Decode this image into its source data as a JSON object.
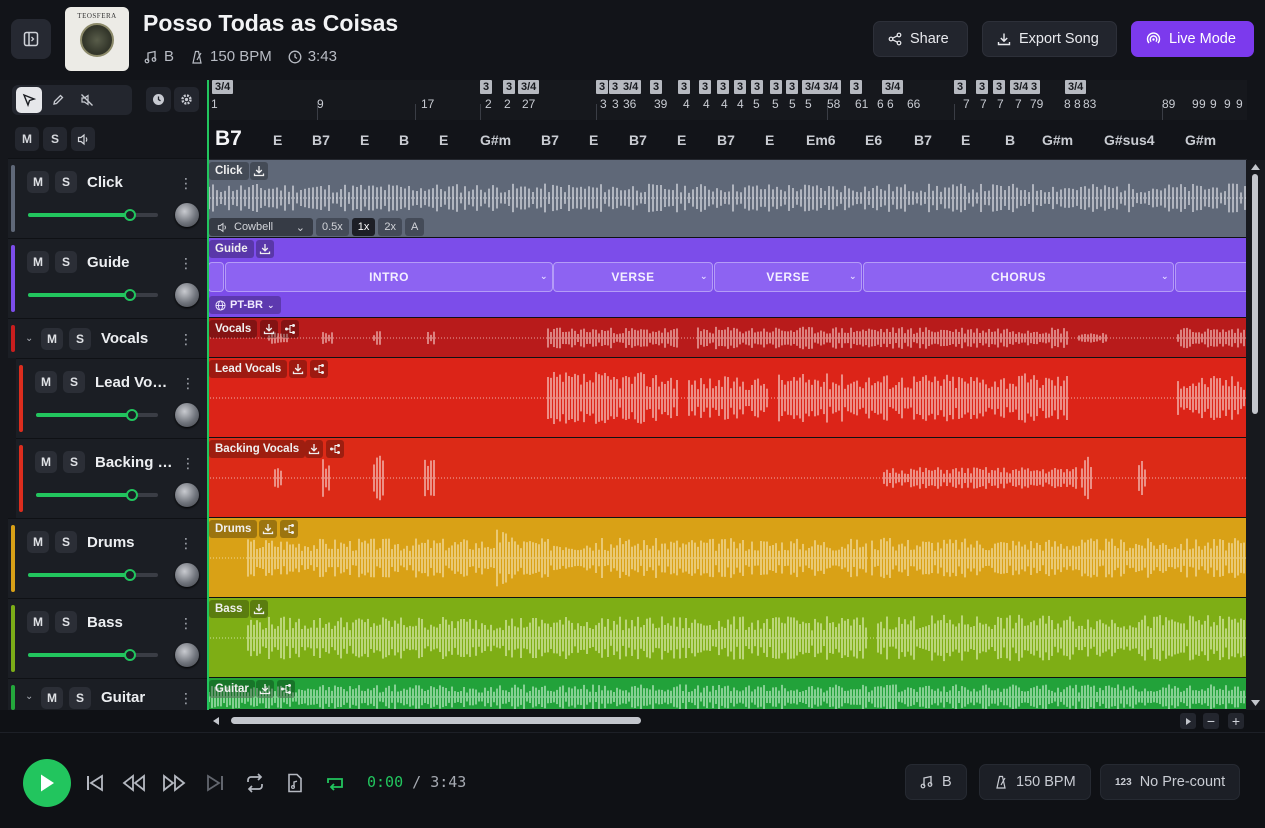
{
  "header": {
    "title": "Posso Todas as Coisas",
    "key": "B",
    "bpm": "150 BPM",
    "duration": "3:43",
    "cover_text": "TEOSFERA",
    "share_label": "Share",
    "export_label": "Export Song",
    "live_label": "Live Mode"
  },
  "mixer": {
    "master_mute": "M",
    "master_solo": "S"
  },
  "tracks": [
    {
      "name": "Click",
      "color": "#5f6878",
      "m": "M",
      "s": "S"
    },
    {
      "name": "Guide",
      "color": "#7c4dea",
      "m": "M",
      "s": "S"
    },
    {
      "name": "Vocals",
      "color": "#c81e1e",
      "m": "M",
      "s": "S"
    },
    {
      "name": "Lead Voc…",
      "color": "#dc2d1e",
      "m": "M",
      "s": "S"
    },
    {
      "name": "Backing …",
      "color": "#dc2d1e",
      "m": "M",
      "s": "S"
    },
    {
      "name": "Drums",
      "color": "#d8a017",
      "m": "M",
      "s": "S"
    },
    {
      "name": "Bass",
      "color": "#7cad18",
      "m": "M",
      "s": "S"
    },
    {
      "name": "Guitar",
      "color": "#24a83c",
      "m": "M",
      "s": "S"
    }
  ],
  "lanes": {
    "click": "Click",
    "guide": "Guide",
    "vocals": "Vocals",
    "lead": "Lead Vocals",
    "backing": "Backing Vocals",
    "drums": "Drums",
    "bass": "Bass",
    "guitar": "Guitar"
  },
  "click_controls": {
    "sound": "Cowbell",
    "rates": [
      "0.5x",
      "1x",
      "2x"
    ],
    "accent": "A"
  },
  "guide": {
    "language": "PT-BR",
    "sections": [
      "INTRO",
      "VERSE",
      "VERSE",
      "CHORUS",
      "VE"
    ]
  },
  "ruler": {
    "bars": [
      "1",
      "9",
      "17",
      "2",
      "2",
      "27",
      "3",
      "3",
      "36",
      "39",
      "4",
      "4",
      "4",
      "4",
      "5",
      "5",
      "5",
      "5",
      "58",
      "61",
      "6",
      "6",
      "66",
      "7",
      "7",
      "7",
      "7",
      "79",
      "8",
      "8",
      "83",
      "89",
      "9",
      "9",
      "9",
      "9",
      "9"
    ],
    "time_signatures": [
      "3/4",
      "3",
      "3",
      "3/4",
      "3",
      "3",
      "3/4",
      "3",
      "3",
      "3",
      "3",
      "3",
      "3",
      "3",
      "3",
      "3/4",
      "3/4",
      "3",
      "3/4",
      "3",
      "3",
      "3",
      "3/4",
      "3",
      "3/4"
    ]
  },
  "chords": [
    "B7",
    "E",
    "B7",
    "E",
    "B",
    "E",
    "G#m",
    "B7",
    "E",
    "B7",
    "E",
    "B7",
    "E",
    "Em6",
    "E6",
    "B7",
    "E",
    "B",
    "G#m",
    "G#sus4",
    "G#m"
  ],
  "transport": {
    "current_time": "0:00",
    "separator": "/",
    "total_time": "3:43",
    "key_pill": "B",
    "bpm_pill": "150 BPM",
    "precount_pill": "No Pre-count"
  }
}
